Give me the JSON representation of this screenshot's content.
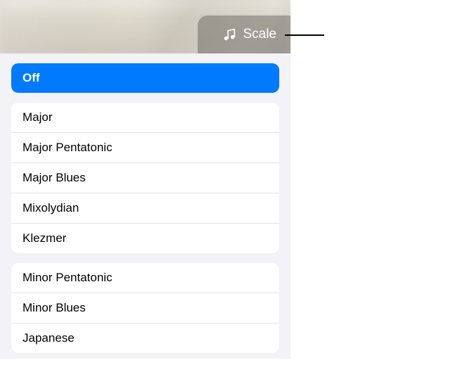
{
  "header": {
    "scale_label": "Scale",
    "scale_icon": "music-scale-icon"
  },
  "sections": {
    "off": {
      "label": "Off"
    },
    "major": [
      {
        "label": "Major"
      },
      {
        "label": "Major Pentatonic"
      },
      {
        "label": "Major Blues"
      },
      {
        "label": "Mixolydian"
      },
      {
        "label": "Klezmer"
      }
    ],
    "minor": [
      {
        "label": "Minor Pentatonic"
      },
      {
        "label": "Minor Blues"
      },
      {
        "label": "Japanese"
      }
    ]
  }
}
